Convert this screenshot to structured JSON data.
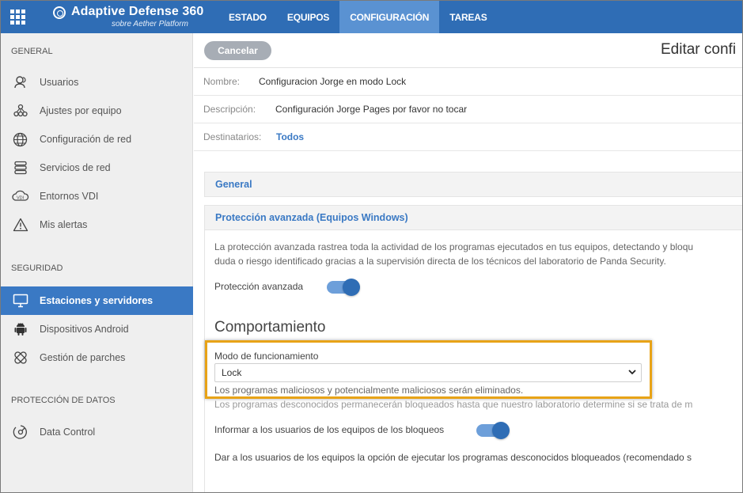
{
  "header": {
    "app_title": "Adaptive Defense 360",
    "app_subtitle": "sobre Aether Platform",
    "tabs": [
      {
        "label": "ESTADO",
        "active": false
      },
      {
        "label": "EQUIPOS",
        "active": false
      },
      {
        "label": "CONFIGURACIÓN",
        "active": true
      },
      {
        "label": "TAREAS",
        "active": false
      }
    ]
  },
  "sidebar": {
    "section_general": "GENERAL",
    "general_items": [
      {
        "label": "Usuarios",
        "icon": "users-icon"
      },
      {
        "label": "Ajustes por equipo",
        "icon": "network-nodes-icon"
      },
      {
        "label": "Configuración de red",
        "icon": "globe-icon"
      },
      {
        "label": "Servicios de red",
        "icon": "server-icon"
      },
      {
        "label": "Entornos VDI",
        "icon": "vdi-icon"
      },
      {
        "label": "Mis alertas",
        "icon": "warning-icon"
      }
    ],
    "section_seguridad": "SEGURIDAD",
    "seguridad_items": [
      {
        "label": "Estaciones y servidores",
        "icon": "monitor-icon",
        "active": true
      },
      {
        "label": "Dispositivos Android",
        "icon": "android-icon"
      },
      {
        "label": "Gestión de parches",
        "icon": "patch-icon"
      }
    ],
    "section_datos": "PROTECCIÓN DE DATOS",
    "datos_items": [
      {
        "label": "Data Control",
        "icon": "data-control-icon"
      }
    ]
  },
  "toolbar": {
    "cancel_label": "Cancelar",
    "page_title": "Editar confi"
  },
  "form": {
    "name_label": "Nombre:",
    "name_value": "Configuracion Jorge en modo Lock",
    "description_label": "Descripción:",
    "description_value": "Configuración Jorge Pages por favor no tocar",
    "recipients_label": "Destinatarios:",
    "recipients_value": "Todos"
  },
  "panels": {
    "general_title": "General",
    "advanced_title": "Protección avanzada (Equipos Windows)",
    "advanced_desc_line1": "La protección avanzada rastrea toda la actividad de los programas ejecutados en tus equipos, detectando y bloqu",
    "advanced_desc_line2": "duda o riesgo identificado gracias a la supervisión directa de los técnicos del laboratorio de Panda Security.",
    "advanced_toggle_label": "Protección avanzada",
    "advanced_toggle_on": true,
    "behavior_title": "Comportamiento",
    "mode_label": "Modo de funcionamiento",
    "mode_value": "Lock",
    "mode_desc": "Los programas maliciosos y potencialmente maliciosos serán eliminados.",
    "unknown_desc": "Los programas desconocidos permanecerán bloqueados hasta que nuestro laboratorio determine si se trata de m",
    "inform_label": "Informar a los usuarios de los equipos de los bloqueos",
    "inform_toggle_on": true,
    "allow_label": "Dar a los usuarios de los equipos la opción de ejecutar los programas desconocidos bloqueados (recomendado s"
  }
}
